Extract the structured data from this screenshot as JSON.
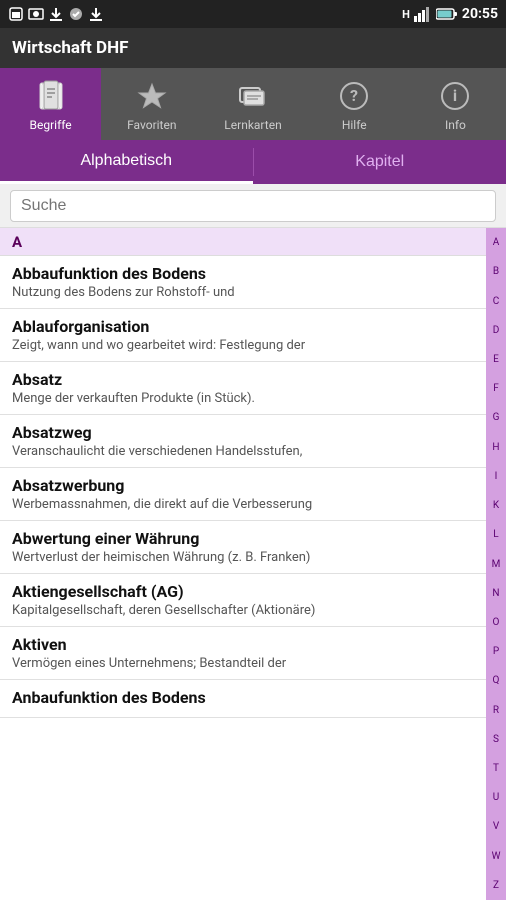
{
  "statusBar": {
    "time": "20:55",
    "signal": "H",
    "icons": [
      "sim",
      "wifi-bars",
      "battery"
    ]
  },
  "appTitle": "Wirtschaft DHF",
  "tabs": [
    {
      "id": "begriffe",
      "label": "Begriffe",
      "active": true
    },
    {
      "id": "favoriten",
      "label": "Favoriten",
      "active": false
    },
    {
      "id": "lernkarten",
      "label": "Lernkarten",
      "active": false
    },
    {
      "id": "hilfe",
      "label": "Hilfe",
      "active": false
    },
    {
      "id": "info",
      "label": "Info",
      "active": false
    }
  ],
  "segments": [
    {
      "id": "alphabetisch",
      "label": "Alphabetisch",
      "active": true
    },
    {
      "id": "kapitel",
      "label": "Kapitel",
      "active": false
    }
  ],
  "search": {
    "placeholder": "Suche",
    "value": ""
  },
  "alphabet": [
    "A",
    "B",
    "C",
    "D",
    "E",
    "F",
    "G",
    "H",
    "I",
    "K",
    "L",
    "M",
    "N",
    "O",
    "P",
    "Q",
    "R",
    "S",
    "T",
    "U",
    "V",
    "W",
    "Z"
  ],
  "sectionHeader": "A",
  "entries": [
    {
      "title": "Abbaufunktion des Bodens",
      "subtitle": "Nutzung des Bodens zur Rohstoff- und"
    },
    {
      "title": "Ablauforganisation",
      "subtitle": "Zeigt, wann und wo gearbeitet wird: Festlegung der"
    },
    {
      "title": "Absatz",
      "subtitle": "Menge der verkauften Produkte (in Stück)."
    },
    {
      "title": "Absatzweg",
      "subtitle": "Veranschaulicht die verschiedenen Handelsstufen,"
    },
    {
      "title": "Absatzwerbung",
      "subtitle": "Werbemassnahmen, die direkt auf die Verbesserung"
    },
    {
      "title": "Abwertung einer Währung",
      "subtitle": "Wertverlust der heimischen Währung (z. B. Franken)"
    },
    {
      "title": "Aktiengesellschaft (AG)",
      "subtitle": "Kapitalgesellschaft, deren Gesellschafter (Aktionäre)"
    },
    {
      "title": "Aktiven",
      "subtitle": "Vermögen eines Unternehmens; Bestandteil der"
    },
    {
      "title": "Anbaufunktion des Bodens",
      "subtitle": ""
    }
  ],
  "colors": {
    "purple": "#7b2d8b",
    "lightPurple": "#d4a0e0",
    "darkBg": "#333"
  }
}
